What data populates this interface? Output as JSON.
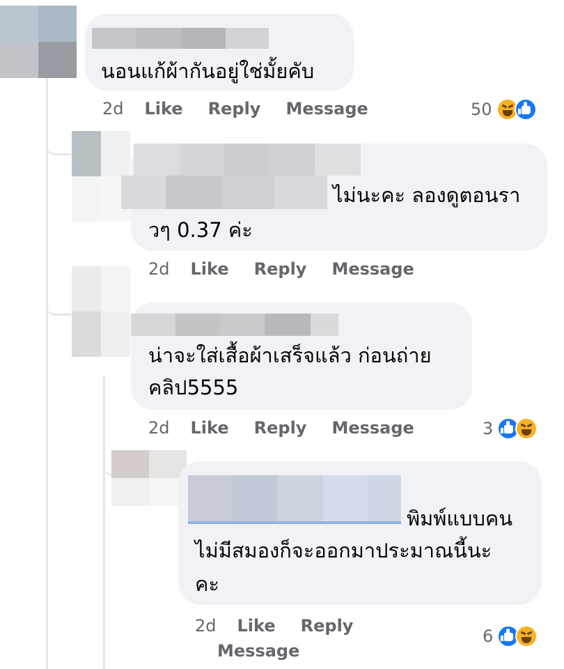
{
  "comments": [
    {
      "text_lines": [
        "นอนแก้ผ้ากันอยู่ใช่มั้ยคับ"
      ],
      "time": "2d",
      "like": "Like",
      "reply": "Reply",
      "message": "Message",
      "reaction_count": "50",
      "reactions": [
        "haha",
        "like"
      ]
    },
    {
      "text_lines": [
        "ไม่นะคะ ลองดูตอนรา",
        "วๆ 0.37 ค่ะ"
      ],
      "time": "2d",
      "like": "Like",
      "reply": "Reply",
      "message": "Message"
    },
    {
      "text_lines": [
        "น่าจะใส่เสื้อผ้าเสร็จแล้ว ก่อนถ่าย",
        "คลิป5555"
      ],
      "time": "2d",
      "like": "Like",
      "reply": "Reply",
      "message": "Message",
      "reaction_count": "3",
      "reactions": [
        "like",
        "haha"
      ]
    },
    {
      "text_lines": [
        "พิมพ์แบบคน",
        "ไม่มีสมองก็จะออกมาประมาณนี้นะ",
        "คะ"
      ],
      "time": "2d",
      "like": "Like",
      "reply": "Reply",
      "message": "Message",
      "reaction_count": "6",
      "reactions": [
        "like",
        "haha"
      ]
    }
  ],
  "colors": {
    "bubble": "#f0f2f5",
    "meta_text": "#65676b",
    "like_blue": "#1877f2",
    "haha_yellow": "#f7b125",
    "thread_line": "#e4e6eb"
  }
}
